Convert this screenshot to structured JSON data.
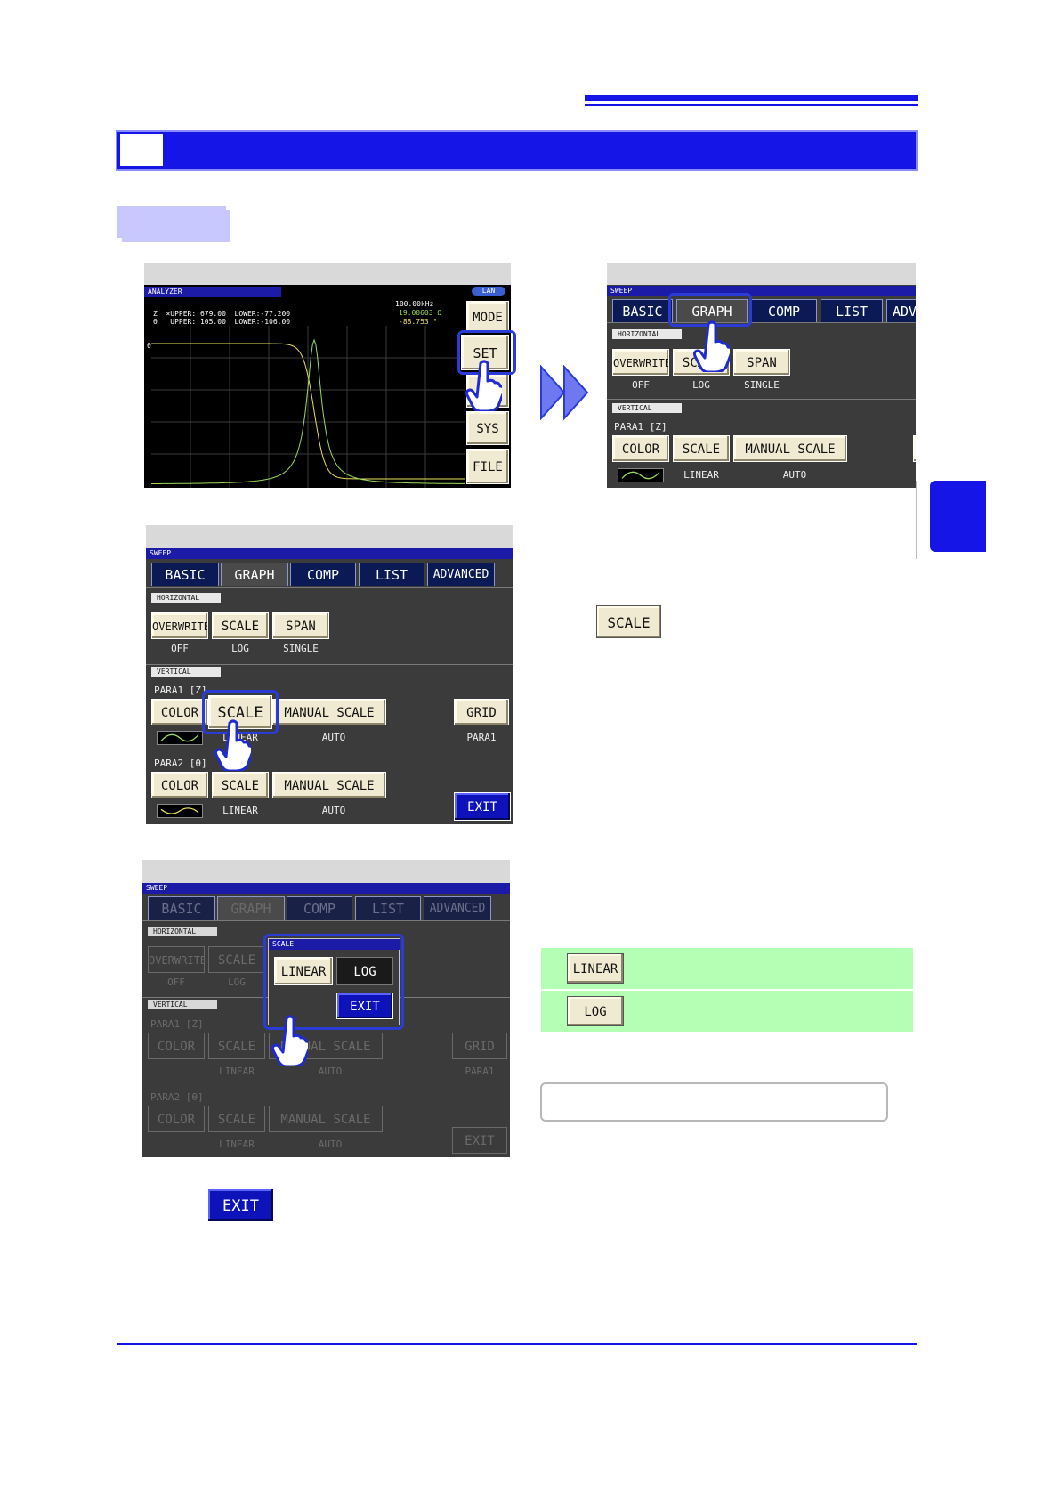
{
  "colors": {
    "accent_blue": "#1515e8",
    "section_lilac": "#c8c8ff",
    "green_row": "#b4ffb4",
    "trace": "#9bd95a"
  },
  "analyzer": {
    "title": "ANALYZER",
    "lan": "LAN",
    "readout": {
      "row1": "Z  ×UPPER: 679.00  LOWER:-77.200",
      "row2": "θ   UPPER: 105.00  LOWER:-106.00",
      "freq": "100.00kHz",
      "z_val": "19.00603 Ω",
      "theta_val": "-88.753 °"
    },
    "axis_marker": "θ",
    "side": [
      "MODE",
      "SET",
      "ADJ",
      "SYS",
      "FILE"
    ]
  },
  "sweep": {
    "title": "SWEEP",
    "tabs": [
      "BASIC",
      "GRAPH",
      "COMP",
      "LIST",
      "ADVANCED"
    ],
    "tabs_cut": [
      "BASIC",
      "GRAPH",
      "COMP",
      "LIST",
      "ADV"
    ],
    "horizontal": "HORIZONTAL",
    "vertical": "VERTICAL",
    "overwrite": "OVERWRITE",
    "scale": "SCALE",
    "span": "SPAN",
    "overwrite_val": "OFF",
    "scale_val": "LOG",
    "span_val": "SINGLE",
    "para1": "PARA1  [Z]",
    "para2": "PARA2  [θ]",
    "color": "COLOR",
    "manual_scale": "MANUAL  SCALE",
    "linear": "LINEAR",
    "auto": "AUTO",
    "grid": "GRID",
    "grid_val": "PARA1",
    "exit": "EXIT"
  },
  "popup": {
    "title": "SCALE",
    "linear": "LINEAR",
    "log": "LOG",
    "exit": "EXIT"
  },
  "steps": {
    "scale_key": "SCALE",
    "exit_key": "EXIT"
  },
  "options": [
    {
      "key": "LINEAR"
    },
    {
      "key": "LOG"
    }
  ],
  "trace_shape": {
    "resonance_frac": 0.52,
    "phase_high_deg": 90,
    "phase_low_deg": -90
  }
}
